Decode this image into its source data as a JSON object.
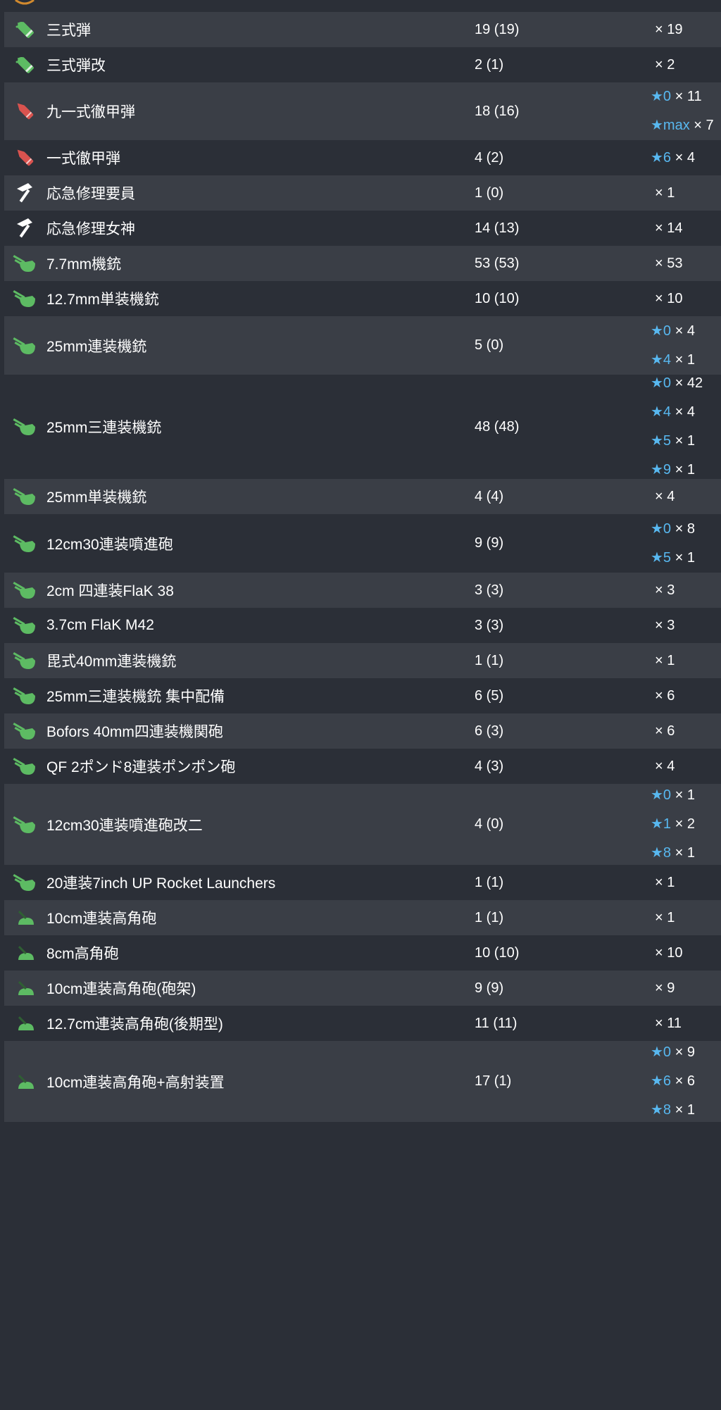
{
  "colors": {
    "bg_dark": "#2b2f37",
    "bg_light": "#3a3e46",
    "star": "#58b8f0",
    "text": "#ffffff"
  },
  "rows": [
    {
      "icon": "shell-icon",
      "icon_color": "#5dbb63",
      "name": "三式弾",
      "count": "19 (19)",
      "qty": [
        {
          "star": "",
          "mult": "× 19"
        }
      ]
    },
    {
      "icon": "shell-icon",
      "icon_color": "#5dbb63",
      "name": "三式弾改",
      "count": "2 (1)",
      "qty": [
        {
          "star": "",
          "mult": "× 2"
        }
      ]
    },
    {
      "icon": "ap-shell-icon",
      "icon_color": "#d9534f",
      "name": "九一式徹甲弾",
      "count": "18 (16)",
      "qty": [
        {
          "star": "★0",
          "mult": " × 11"
        },
        {
          "star": "★max",
          "mult": " × 7"
        }
      ]
    },
    {
      "icon": "ap-shell-icon",
      "icon_color": "#d9534f",
      "name": "一式徹甲弾",
      "count": "4 (2)",
      "qty": [
        {
          "star": "★6",
          "mult": " × 4"
        }
      ]
    },
    {
      "icon": "repair-icon",
      "icon_color": "#ffffff",
      "name": "応急修理要員",
      "count": "1 (0)",
      "qty": [
        {
          "star": "",
          "mult": "× 1"
        }
      ]
    },
    {
      "icon": "repair-icon",
      "icon_color": "#ffffff",
      "name": "応急修理女神",
      "count": "14 (13)",
      "qty": [
        {
          "star": "",
          "mult": "× 14"
        }
      ]
    },
    {
      "icon": "aa-gun-icon",
      "icon_color": "#5dbb63",
      "name": "7.7mm機銃",
      "count": "53 (53)",
      "qty": [
        {
          "star": "",
          "mult": "× 53"
        }
      ]
    },
    {
      "icon": "aa-gun-icon",
      "icon_color": "#5dbb63",
      "name": "12.7mm単装機銃",
      "count": "10 (10)",
      "qty": [
        {
          "star": "",
          "mult": "× 10"
        }
      ]
    },
    {
      "icon": "aa-gun-icon",
      "icon_color": "#5dbb63",
      "name": "25mm連装機銃",
      "count": "5 (0)",
      "qty": [
        {
          "star": "★0",
          "mult": " × 4"
        },
        {
          "star": "★4",
          "mult": " × 1"
        }
      ]
    },
    {
      "icon": "aa-gun-icon",
      "icon_color": "#5dbb63",
      "name": "25mm三連装機銃",
      "count": "48 (48)",
      "qty": [
        {
          "star": "★0",
          "mult": " × 42"
        },
        {
          "star": "★4",
          "mult": " × 4"
        },
        {
          "star": "★5",
          "mult": " × 1"
        },
        {
          "star": "★9",
          "mult": " × 1"
        }
      ]
    },
    {
      "icon": "aa-gun-icon",
      "icon_color": "#5dbb63",
      "name": "25mm単装機銃",
      "count": "4 (4)",
      "qty": [
        {
          "star": "",
          "mult": "× 4"
        }
      ]
    },
    {
      "icon": "aa-gun-icon",
      "icon_color": "#5dbb63",
      "name": "12cm30連装噴進砲",
      "count": "9 (9)",
      "qty": [
        {
          "star": "★0",
          "mult": " × 8"
        },
        {
          "star": "★5",
          "mult": " × 1"
        }
      ]
    },
    {
      "icon": "aa-gun-icon",
      "icon_color": "#5dbb63",
      "name": "2cm 四連装FlaK 38",
      "count": "3 (3)",
      "qty": [
        {
          "star": "",
          "mult": "× 3"
        }
      ]
    },
    {
      "icon": "aa-gun-icon",
      "icon_color": "#5dbb63",
      "name": "3.7cm FlaK M42",
      "count": "3 (3)",
      "qty": [
        {
          "star": "",
          "mult": "× 3"
        }
      ]
    },
    {
      "icon": "aa-gun-icon",
      "icon_color": "#5dbb63",
      "name": "毘式40mm連装機銃",
      "count": "1 (1)",
      "qty": [
        {
          "star": "",
          "mult": "× 1"
        }
      ]
    },
    {
      "icon": "aa-gun-icon",
      "icon_color": "#5dbb63",
      "name": "25mm三連装機銃 集中配備",
      "count": "6 (5)",
      "qty": [
        {
          "star": "",
          "mult": "× 6"
        }
      ]
    },
    {
      "icon": "aa-gun-icon",
      "icon_color": "#5dbb63",
      "name": "Bofors 40mm四連装機関砲",
      "count": "6 (3)",
      "qty": [
        {
          "star": "",
          "mult": "× 6"
        }
      ]
    },
    {
      "icon": "aa-gun-icon",
      "icon_color": "#5dbb63",
      "name": "QF 2ポンド8連装ポンポン砲",
      "count": "4 (3)",
      "qty": [
        {
          "star": "",
          "mult": "× 4"
        }
      ]
    },
    {
      "icon": "aa-gun-icon",
      "icon_color": "#5dbb63",
      "name": "12cm30連装噴進砲改二",
      "count": "4 (0)",
      "qty": [
        {
          "star": "★0",
          "mult": " × 1"
        },
        {
          "star": "★1",
          "mult": " × 2"
        },
        {
          "star": "★8",
          "mult": " × 1"
        }
      ]
    },
    {
      "icon": "aa-gun-icon",
      "icon_color": "#5dbb63",
      "name": "20連装7inch UP Rocket Launchers",
      "count": "1 (1)",
      "qty": [
        {
          "star": "",
          "mult": "× 1"
        }
      ]
    },
    {
      "icon": "ha-gun-icon",
      "icon_color": "#5dbb63",
      "name": "10cm連装高角砲",
      "count": "1 (1)",
      "qty": [
        {
          "star": "",
          "mult": "× 1"
        }
      ]
    },
    {
      "icon": "ha-gun-icon",
      "icon_color": "#5dbb63",
      "name": "8cm高角砲",
      "count": "10 (10)",
      "qty": [
        {
          "star": "",
          "mult": "× 10"
        }
      ]
    },
    {
      "icon": "ha-gun-icon",
      "icon_color": "#5dbb63",
      "name": "10cm連装高角砲(砲架)",
      "count": "9 (9)",
      "qty": [
        {
          "star": "",
          "mult": "× 9"
        }
      ]
    },
    {
      "icon": "ha-gun-icon",
      "icon_color": "#5dbb63",
      "name": "12.7cm連装高角砲(後期型)",
      "count": "11 (11)",
      "qty": [
        {
          "star": "",
          "mult": "× 11"
        }
      ]
    },
    {
      "icon": "ha-gun-icon",
      "icon_color": "#5dbb63",
      "name": "10cm連装高角砲+高射装置",
      "count": "17 (1)",
      "qty": [
        {
          "star": "★0",
          "mult": " × 9"
        },
        {
          "star": "★6",
          "mult": " × 6"
        },
        {
          "star": "★8",
          "mult": " × 1"
        }
      ]
    }
  ]
}
